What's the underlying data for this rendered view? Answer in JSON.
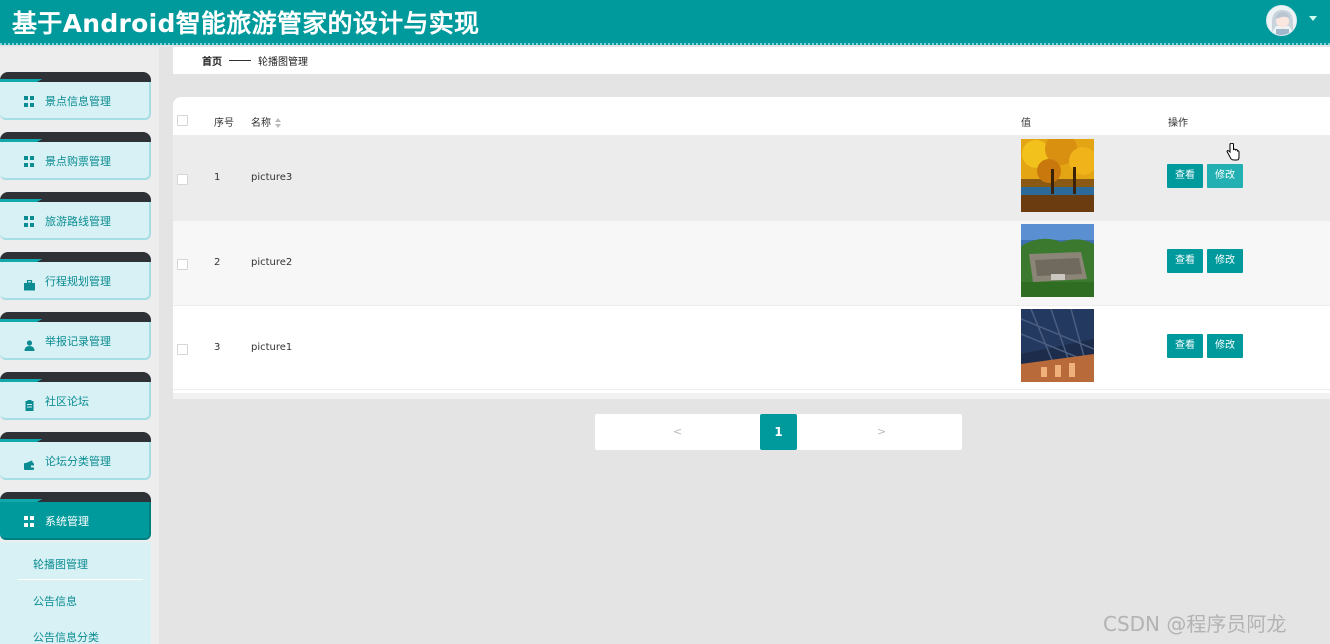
{
  "header": {
    "title": "基于Android智能旅游管家的设计与实现"
  },
  "sidebar": {
    "items": [
      {
        "label": "景点信息管理",
        "icon": "grid-icon"
      },
      {
        "label": "景点购票管理",
        "icon": "grid-icon"
      },
      {
        "label": "旅游路线管理",
        "icon": "grid-icon"
      },
      {
        "label": "行程规划管理",
        "icon": "briefcase-icon"
      },
      {
        "label": "举报记录管理",
        "icon": "user-icon"
      },
      {
        "label": "社区论坛",
        "icon": "clipboard-icon"
      },
      {
        "label": "论坛分类管理",
        "icon": "wallet-icon"
      },
      {
        "label": "系统管理",
        "icon": "grid-icon",
        "active": true
      }
    ],
    "submenu": [
      "轮播图管理",
      "公告信息",
      "公告信息分类"
    ]
  },
  "breadcrumb": {
    "home": "首页",
    "current": "轮播图管理"
  },
  "table": {
    "headers": {
      "index": "序号",
      "name": "名称",
      "value": "值",
      "actions": "操作"
    },
    "rows": [
      {
        "index": "1",
        "name": "picture3",
        "image": "autumn-trees-photo"
      },
      {
        "index": "2",
        "name": "picture2",
        "image": "mountain-cliff-photo"
      },
      {
        "index": "3",
        "name": "picture1",
        "image": "architecture-photo"
      }
    ],
    "view_label": "查看",
    "edit_label": "修改"
  },
  "pagination": {
    "prev": "<",
    "current": "1",
    "next": ">"
  },
  "watermark": "CSDN @程序员阿龙",
  "colors": {
    "primary": "#009a9c",
    "sidebar_bg": "#d7f1f4",
    "tab_dark": "#2e3236"
  }
}
